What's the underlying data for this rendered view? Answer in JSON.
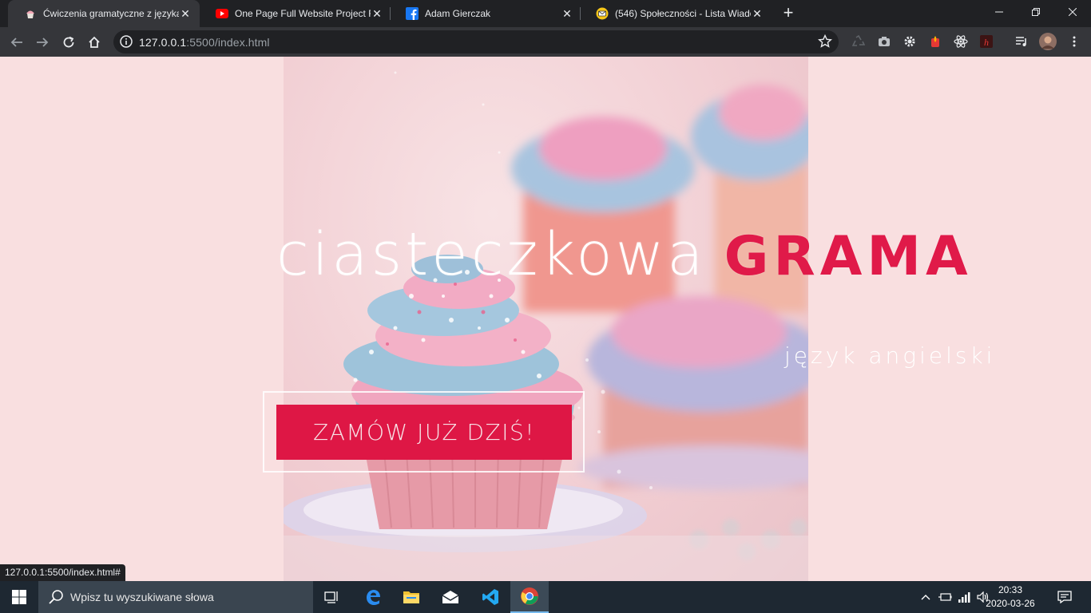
{
  "browser": {
    "tabs": [
      {
        "label": "Ćwiczenia gramatyczne z języka a",
        "icon": "cupcake-favicon-icon",
        "active": true
      },
      {
        "label": "One Page Full Website Project Fo",
        "icon": "youtube-icon",
        "active": false
      },
      {
        "label": "Adam Gierczak",
        "icon": "facebook-icon",
        "active": false
      },
      {
        "label": "(546) Społeczności - Lista Wiado",
        "icon": "mail-smiley-icon",
        "active": false
      }
    ],
    "url_host": "127.0.0.1",
    "url_path": ":5500/index.html",
    "status_url": "127.0.0.1:5500/index.html#"
  },
  "hero": {
    "title_light": "ciasteczkowa",
    "title_bold": "GRAMA",
    "subtitle": "język angielski",
    "cta_label": "ZAMÓW JUŻ DZIŚ!"
  },
  "taskbar": {
    "search_placeholder": "Wpisz tu wyszukiwane słowa",
    "time": "20:33",
    "date": "2020-03-26"
  },
  "colors": {
    "accent": "#e01a49",
    "page_background": "#f9dfe0",
    "cta_background": "#de1745"
  }
}
